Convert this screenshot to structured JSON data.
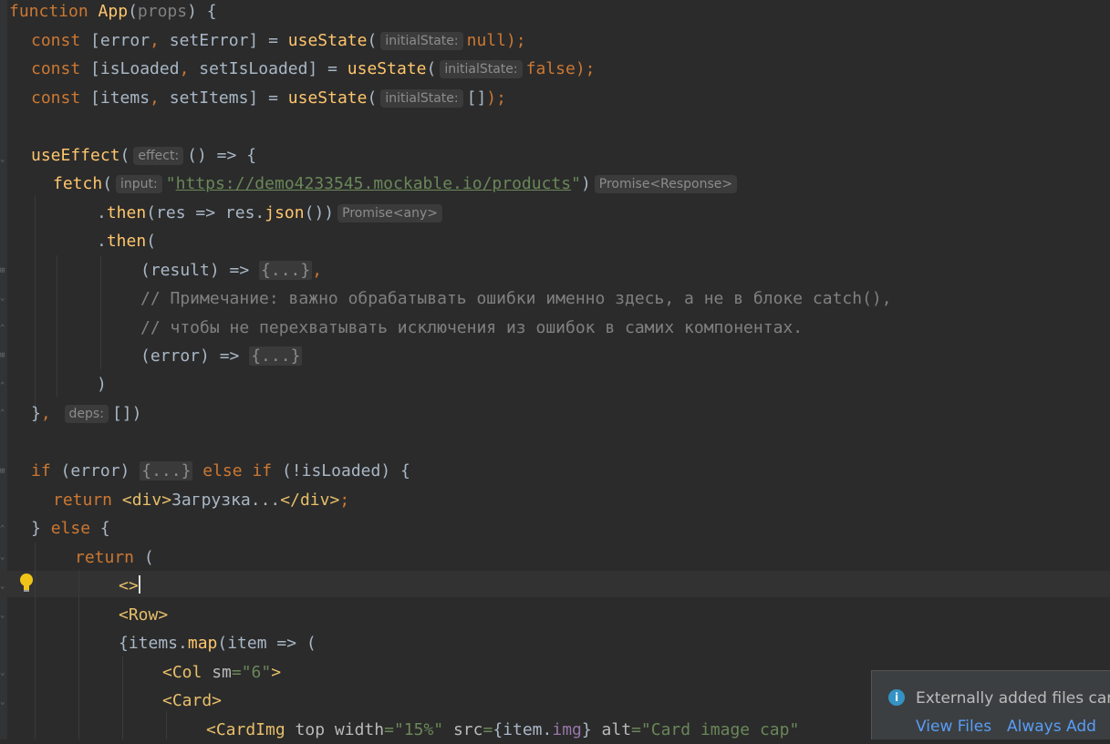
{
  "code": {
    "l1_kw": "function",
    "l1_fn": "App",
    "l1_open": "(",
    "l1_param": "props",
    "l1_close": ") {",
    "l2_kw": "const",
    "l2_a": " [error",
    "l2_comma": ",",
    "l2_b": " setError] = ",
    "l2_fn": "useState",
    "l2_p": "(",
    "l2_hint": "initialState:",
    "l2_val": "null",
    "l2_end": ");",
    "l3_kw": "const",
    "l3_a": " [isLoaded",
    "l3_comma": ",",
    "l3_b": " setIsLoaded] = ",
    "l3_fn": "useState",
    "l3_p": "(",
    "l3_hint": "initialState:",
    "l3_val": "false",
    "l3_end": ");",
    "l4_kw": "const",
    "l4_a": " [items",
    "l4_comma": ",",
    "l4_b": " setItems] = ",
    "l4_fn": "useState",
    "l4_p": "(",
    "l4_hint": "initialState:",
    "l4_val": "[]",
    "l4_end": ");",
    "l6_fn": "useEffect",
    "l6_p": "(",
    "l6_hint": "effect:",
    "l6_rest": "() => {",
    "l7_fn": "fetch",
    "l7_p": "(",
    "l7_hint": "input:",
    "l7_q1": "\"",
    "l7_url": "https://demo4233545.mockable.io/products",
    "l7_q2": "\"",
    "l7_close": ")",
    "l7_type": "Promise<Response>",
    "l8_dot": ".",
    "l8_then": "then",
    "l8_a": "(res => res.",
    "l8_json": "json",
    "l8_b": "())",
    "l8_type": "Promise<any>",
    "l9_dot": ".",
    "l9_then": "then",
    "l9_p": "(",
    "l10_a": "(result) => ",
    "l10_fold": "{...}",
    "l10_comma": ",",
    "l11_cmt": "// Примечание: важно обрабатывать ошибки именно здесь, а не в блоке catch(),",
    "l12_cmt": "// чтобы не перехватывать исключения из ошибок в самих компонентах.",
    "l13_a": "(error) => ",
    "l13_fold": "{...}",
    "l14": ")",
    "l15_a": "}",
    "l15_comma": ",",
    "l15_hint": "deps:",
    "l15_b": "[])",
    "l17_if": "if",
    "l17_a": " (error) ",
    "l17_fold": "{...}",
    "l17_else": " else if",
    "l17_b": " (!isLoaded) {",
    "l18_kw": "return",
    "l18_tag1": "<div>",
    "l18_text": "Загрузка...",
    "l18_tag2": "</div>",
    "l18_semi": ";",
    "l19_a": "} ",
    "l19_else": "else",
    "l19_b": " {",
    "l20_kw": "return",
    "l20_b": " (",
    "l21_tag": "<>",
    "l22_tag": "<Row>",
    "l23_a": "{items.",
    "l23_map": "map",
    "l23_b": "(item => (",
    "l24_tag": "<Col",
    "l24_attr": " sm",
    "l24_eq": "=",
    "l24_val": "\"6\"",
    "l24_end": ">",
    "l25_tag": "<Card>",
    "l26_tag": "<CardImg",
    "l26_top": " top",
    "l26_width": " width",
    "l26_eq1": "=",
    "l26_wval": "\"15%\"",
    "l26_src": " src",
    "l26_eq2": "=",
    "l26_expr_a": "{item.",
    "l26_img": "img",
    "l26_expr_b": "}",
    "l26_alt": " alt",
    "l26_eq3": "=",
    "l26_altval": "\"Card image cap\""
  },
  "notification": {
    "icon": "info-icon",
    "text": "Externally added files can be",
    "action_view": "View Files",
    "action_always": "Always Add"
  },
  "colors": {
    "background": "#2b2b2b",
    "keyword": "#cc7832",
    "function": "#ffc66d",
    "string": "#6a8759",
    "comment": "#808080",
    "link": "#589df6"
  }
}
